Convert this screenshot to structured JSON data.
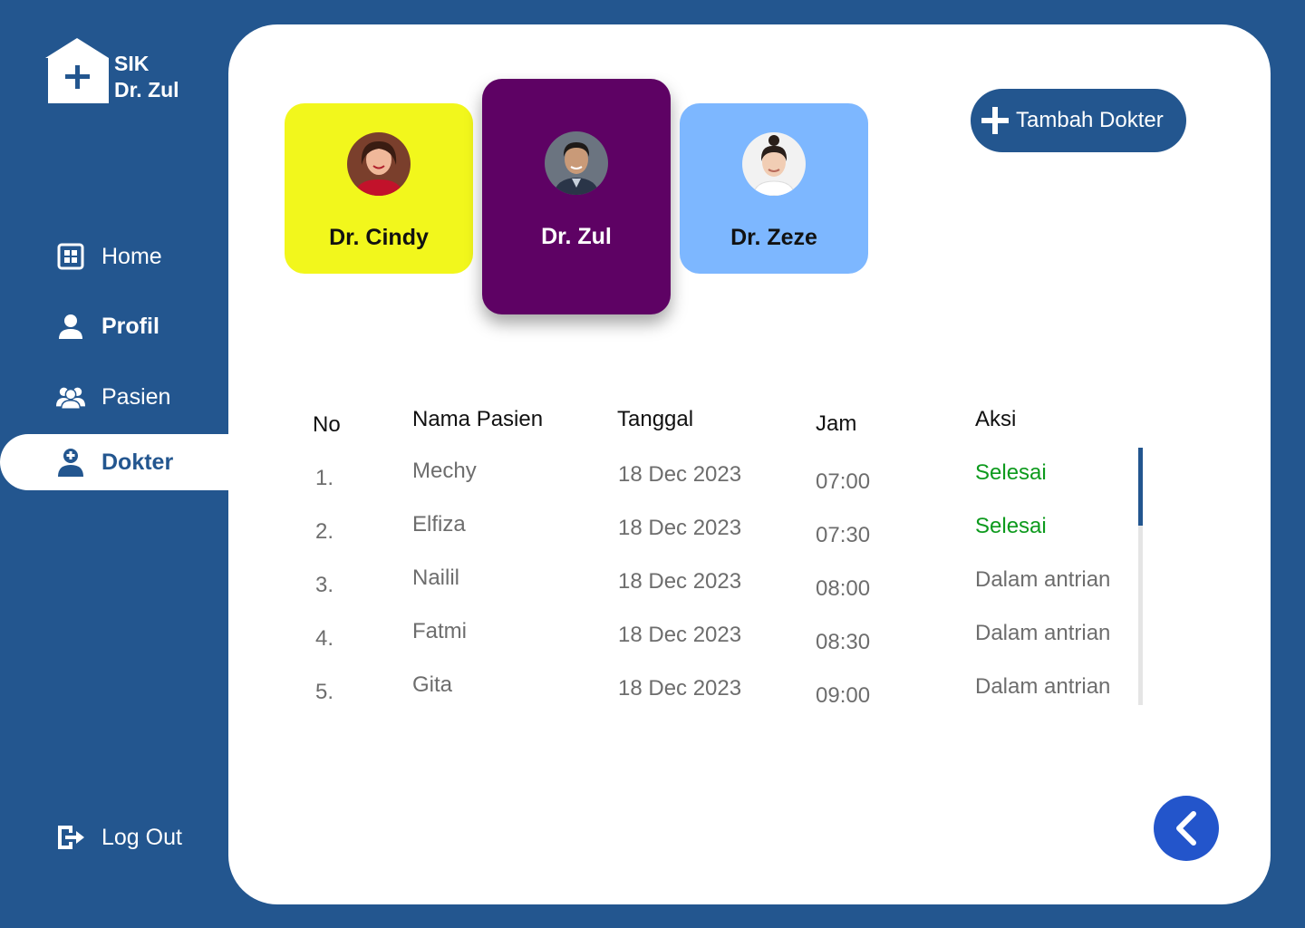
{
  "app": {
    "brand_line1": "SIK",
    "brand_line2": "Dr. Zul"
  },
  "sidebar": {
    "items": [
      {
        "label": "Home",
        "icon": "grid-icon"
      },
      {
        "label": "Profil",
        "icon": "user-icon"
      },
      {
        "label": "Pasien",
        "icon": "users-icon"
      },
      {
        "label": "Dokter",
        "icon": "doctor-icon"
      }
    ],
    "logout": {
      "label": "Log Out",
      "icon": "logout-icon"
    }
  },
  "doctors": [
    {
      "name": "Dr. Cindy",
      "color": "#f2f71c"
    },
    {
      "name": "Dr. Zul",
      "color": "#5e0264"
    },
    {
      "name": "Dr. Zeze",
      "color": "#7db7ff"
    }
  ],
  "add_button": {
    "label": "Tambah Dokter"
  },
  "table": {
    "headers": {
      "no": "No",
      "name": "Nama Pasien",
      "date": "Tanggal",
      "time": "Jam",
      "action": "Aksi"
    },
    "rows": [
      {
        "no": "1.",
        "name": "Mechy",
        "date": "18 Dec 2023",
        "time": "07:00",
        "action": "Selesai"
      },
      {
        "no": "2.",
        "name": "Elfiza",
        "date": "18 Dec 2023",
        "time": "07:30",
        "action": "Selesai"
      },
      {
        "no": "3.",
        "name": "Nailil",
        "date": "18 Dec 2023",
        "time": "08:00",
        "action": "Dalam antrian"
      },
      {
        "no": "4.",
        "name": "Fatmi",
        "date": "18 Dec 2023",
        "time": "08:30",
        "action": "Dalam antrian"
      },
      {
        "no": "5.",
        "name": "Gita",
        "date": "18 Dec 2023",
        "time": "09:00",
        "action": "Dalam antrian"
      }
    ]
  },
  "colors": {
    "primary": "#23568f",
    "done": "#0d9a1d",
    "back_button": "#2355cb"
  }
}
